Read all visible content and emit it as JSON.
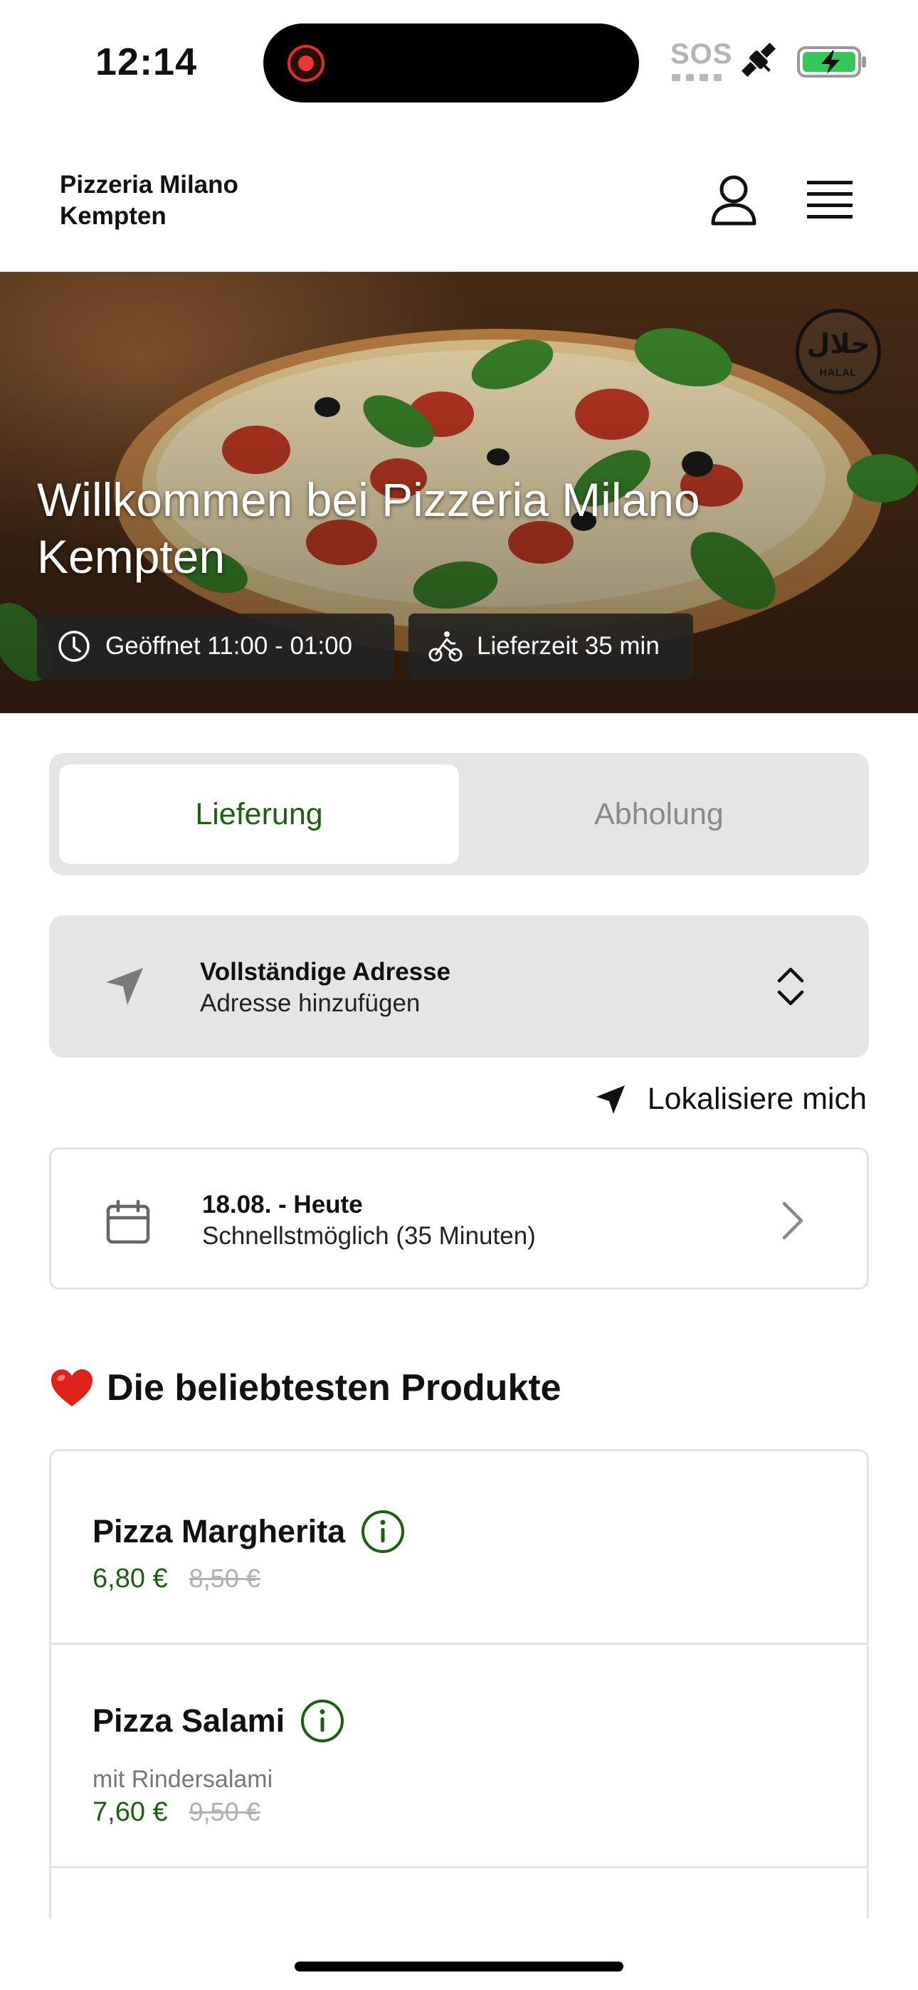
{
  "status_bar": {
    "time": "12:14",
    "sos": "SOS"
  },
  "header": {
    "brand": "Pizzeria Milano Kempten",
    "user_icon": "user-icon",
    "menu_icon": "hamburger-menu-icon"
  },
  "hero": {
    "title": "Willkommen bei Pizzeria Milano Kempten",
    "badge_arabic": "حلال",
    "badge_text": "HALAL",
    "open_hours": "Geöffnet 11:00 - 01:00",
    "delivery_time": "Lieferzeit 35 min"
  },
  "mode_toggle": {
    "delivery": "Lieferung",
    "pickup": "Abholung",
    "selected": "delivery",
    "active_color": "#1c5f12"
  },
  "address": {
    "title": "Vollständige Adresse",
    "subtitle": "Adresse hinzufügen"
  },
  "locate": {
    "label": "Lokalisiere mich"
  },
  "schedule": {
    "title": "18.08. - Heute",
    "subtitle": "Schnellstmöglich (35 Minuten)"
  },
  "popular": {
    "title": "Die beliebtesten Produkte",
    "products": [
      {
        "name": "Pizza Margherita",
        "description": "",
        "price": "6,80 €",
        "old_price": "8,50 €"
      },
      {
        "name": "Pizza Salami",
        "description": "mit Rindersalami",
        "price": "7,60 €",
        "old_price": "9,50 €"
      }
    ]
  },
  "colors": {
    "brand_green": "#1c5f12",
    "toggle_bg": "#e5e5e5",
    "muted_text": "#8a8a8a"
  }
}
